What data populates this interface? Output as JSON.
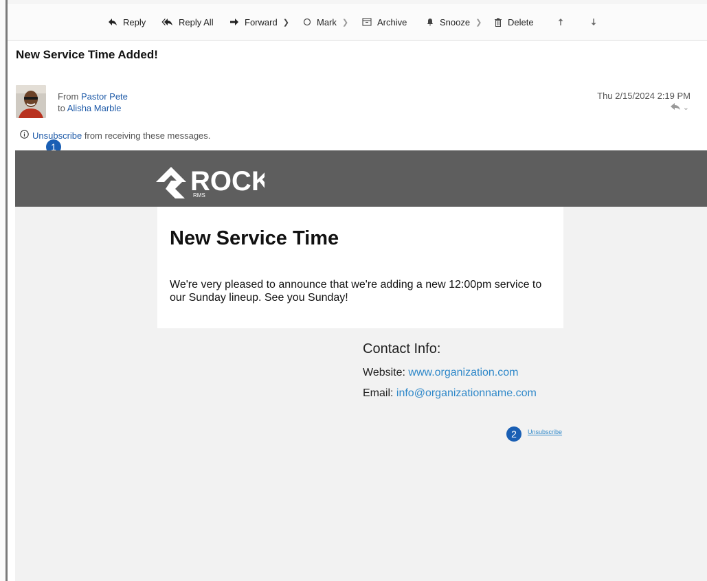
{
  "toolbar": {
    "reply_label": "Reply",
    "reply_all_label": "Reply All",
    "forward_label": "Forward",
    "mark_label": "Mark",
    "archive_label": "Archive",
    "snooze_label": "Snooze",
    "delete_label": "Delete"
  },
  "message": {
    "subject": "New Service Time Added!",
    "from_prefix": "From",
    "from_name": "Pastor Pete",
    "to_prefix": "to",
    "to_name": "Alisha Marble",
    "date": "Thu 2/15/2024 2:19 PM"
  },
  "unsubscribe_notice": {
    "link_label": "Unsubscribe",
    "rest_text": " from receiving these messages."
  },
  "badges": {
    "one": "1",
    "two": "2"
  },
  "email": {
    "logo_text": "ROCK",
    "logo_sub": "RMS",
    "heading": "New Service Time",
    "body": "We're very pleased to announce that we're adding a new 12:00pm service to our Sunday lineup. See you Sunday!",
    "contact_heading": "Contact Info:",
    "website_label": "Website: ",
    "website_value": "www.organization.com",
    "email_label": "Email: ",
    "email_value": "info@organizationname.com",
    "footer_unsubscribe": "Unsubscribe"
  },
  "colors": {
    "link": "#1e5aa8",
    "email_link": "#2f88c9",
    "badge": "#1a5fb4",
    "banner": "#5e5e5e",
    "email_background": "#f2f2f2"
  }
}
